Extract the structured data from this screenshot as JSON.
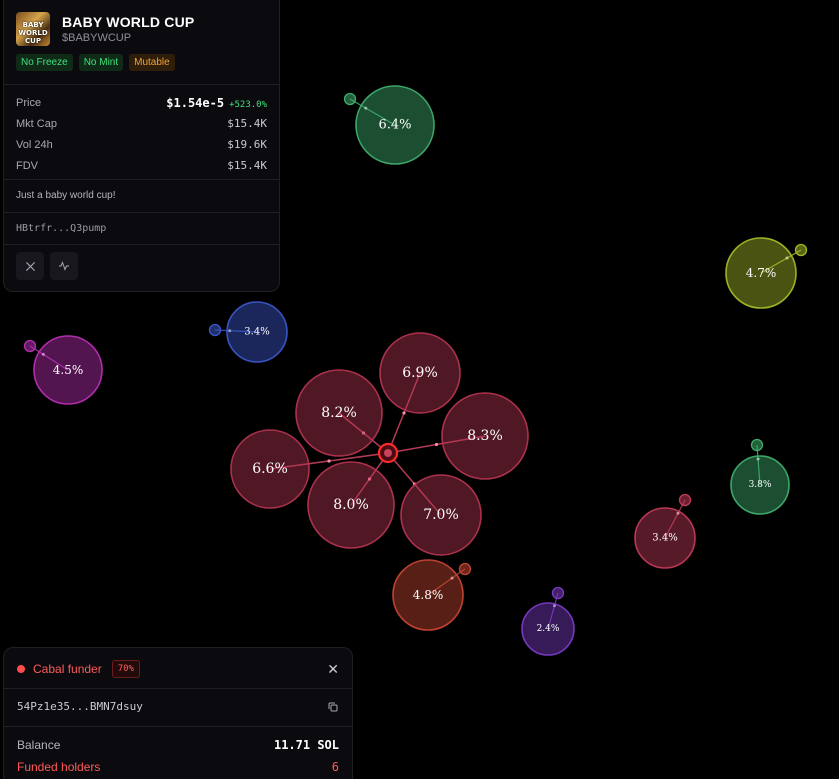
{
  "token": {
    "name": "BABY WORLD CUP",
    "symbol": "$BABYWCUP",
    "logo_text": "BABY\nWORLD CUP",
    "badges": [
      {
        "label": "No Freeze",
        "color": "#3fe07a"
      },
      {
        "label": "No Mint",
        "color": "#3fe07a"
      },
      {
        "label": "Mutable",
        "color": "#f0a23c"
      }
    ],
    "stats": {
      "price_label": "Price",
      "price_value": "$1.54e-5",
      "price_change": "+523.0%",
      "mktcap_label": "Mkt Cap",
      "mktcap_value": "$15.4K",
      "vol_label": "Vol 24h",
      "vol_value": "$19.6K",
      "fdv_label": "FDV",
      "fdv_value": "$15.4K"
    },
    "description": "Just a baby world cup!",
    "address": "HBtrfr...Q3pump",
    "social_icons": [
      "x-icon",
      "chart-activity-icon"
    ]
  },
  "cabal_panel": {
    "title": "Cabal funder",
    "percent": "70%",
    "wallet": "54Pz1e35...BMN7dsuy",
    "balance_label": "Balance",
    "balance_value": "11.71 SOL",
    "funded_label": "Funded holders",
    "funded_value": "6"
  },
  "bubble_map": {
    "hub_color": "#ff2a2a",
    "cluster": [
      {
        "label": "6.9%",
        "color": "#b2344f"
      },
      {
        "label": "8.2%",
        "color": "#b2344f"
      },
      {
        "label": "8.3%",
        "color": "#b2344f"
      },
      {
        "label": "6.6%",
        "color": "#b2344f"
      },
      {
        "label": "8.0%",
        "color": "#b2344f"
      },
      {
        "label": "7.0%",
        "color": "#b2344f"
      }
    ],
    "others": [
      {
        "label": "6.4%",
        "color": "#3fae6c"
      },
      {
        "label": "4.7%",
        "color": "#a3b827"
      },
      {
        "label": "3.4%",
        "color": "#3b56c9"
      },
      {
        "label": "4.5%",
        "color": "#b72fb2"
      },
      {
        "label": "3.8%",
        "color": "#3fae6c"
      },
      {
        "label": "3.4%",
        "color": "#c23a5a"
      },
      {
        "label": "4.8%",
        "color": "#c44532"
      },
      {
        "label": "2.4%",
        "color": "#7b3ac4"
      }
    ]
  }
}
